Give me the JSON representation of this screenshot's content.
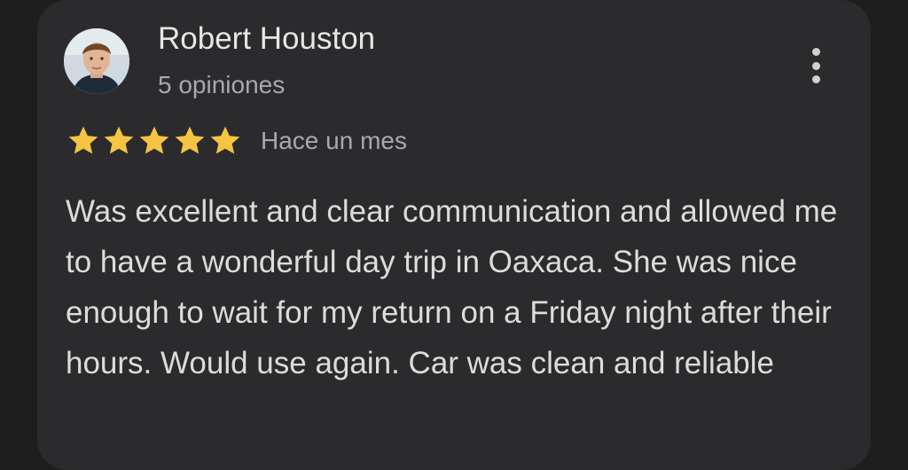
{
  "review": {
    "reviewer_name": "Robert Houston",
    "review_count": "5 opiniones",
    "rating": 5,
    "rating_max": 5,
    "date": "Hace un mes",
    "text": "Was excellent and clear communication and allowed me to have a wonderful day trip in Oaxaca. She was nice enough to wait for my return on a Friday night after their hours. Would use again. Car was clean and reliable"
  },
  "icons": {
    "menu": "more-vert-icon",
    "star": "star-icon"
  },
  "colors": {
    "background": "#1e1e1f",
    "card": "#2b2b2d",
    "star": "#f6c443",
    "primary_text": "#e6e6e6",
    "secondary_text": "#a9a9ab"
  }
}
